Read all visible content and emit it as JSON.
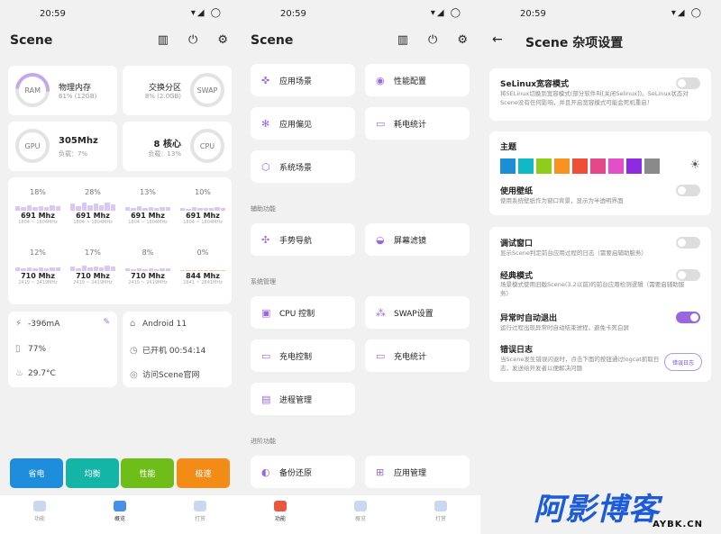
{
  "status": {
    "time": "20:59",
    "icons": "▾◢ ◯"
  },
  "s1": {
    "title": "Scene",
    "mem": {
      "ring": "RAM",
      "label": "物理内存",
      "sub": "61% (12GB)"
    },
    "swap": {
      "ring": "SWAP",
      "label": "交换分区",
      "sub": "8% (2.0GB)"
    },
    "gpu": {
      "ring": "GPU",
      "freq": "305Mhz",
      "sub": "负载：7%"
    },
    "cpu": {
      "ring": "CPU",
      "cores": "8 核心",
      "sub": "负载：13%"
    },
    "cores": [
      {
        "pct": "18%",
        "level": 18,
        "fq": "691 Mhz",
        "rg": "1804 ~ 1804MHz"
      },
      {
        "pct": "28%",
        "level": 28,
        "fq": "691 Mhz",
        "rg": "1804 ~ 1804MHz"
      },
      {
        "pct": "13%",
        "level": 13,
        "fq": "691 Mhz",
        "rg": "1804 ~ 1804MHz"
      },
      {
        "pct": "10%",
        "level": 10,
        "fq": "691 Mhz",
        "rg": "1804 ~ 1804MHz"
      },
      {
        "pct": "12%",
        "level": 12,
        "fq": "710 Mhz",
        "rg": "2419 ~ 2419MHz"
      },
      {
        "pct": "17%",
        "level": 17,
        "fq": "710 Mhz",
        "rg": "2419 ~ 2419MHz"
      },
      {
        "pct": "8%",
        "level": 8,
        "fq": "710 Mhz",
        "rg": "2419 ~ 2419MHz"
      },
      {
        "pct": "0%",
        "level": 0,
        "fq": "844 Mhz",
        "rg": "2841 ~ 2841MHz"
      }
    ],
    "battery": {
      "current": "-396mA",
      "level": "77%",
      "temp": "29.7°C"
    },
    "sys": {
      "android": "Android 11",
      "uptime_label": "已开机",
      "uptime": "00:54:14",
      "site": "访问Scene官网"
    },
    "modes": [
      "省电",
      "均衡",
      "性能",
      "极速"
    ],
    "nav": [
      "功能",
      "概览",
      "打赏"
    ]
  },
  "s2": {
    "title": "Scene",
    "tiles": [
      "应用场景",
      "性能配置",
      "应用偏见",
      "耗电统计",
      "系统场景"
    ],
    "sec1": "辅助功能",
    "aux": [
      "手势导航",
      "屏幕滤镜"
    ],
    "sec2": "系统管理",
    "mgr": [
      "CPU 控制",
      "SWAP设置",
      "充电控制",
      "充电统计",
      "进程管理"
    ],
    "sec3": "进阶功能",
    "adv": [
      "备份还原",
      "应用管理"
    ],
    "nav": [
      "功能",
      "概览",
      "打赏"
    ]
  },
  "s3": {
    "title": "Scene 杂项设置",
    "selinux": {
      "h": "SeLinux宽容模式",
      "d": "将SELinux切换到宽容模式(部分软件叫[关闭Selinux])。SeLinux状态对Scene没有任何影响，并且开启宽容模式可能会死机重启！"
    },
    "theme": {
      "h": "主题",
      "colors": [
        "#1a8fd6",
        "#10b9c6",
        "#8fcd1d",
        "#f7931e",
        "#ef4f37",
        "#e4488a",
        "#e24fc7",
        "#8e2be2",
        "#8a8a8a"
      ]
    },
    "wall": {
      "h": "使用壁纸",
      "d": "使用系统壁纸作为窗口背景，显示为半透明界面"
    },
    "debug": {
      "h": "调试窗口",
      "d": "显示Scene判定前台应用过程的日志（需要启辅助服务）"
    },
    "classic": {
      "h": "经典模式",
      "d": "场景模式使用旧版Scene(3.2以前)的前台应用检测逻辑（需要启辅助服务）"
    },
    "autoexit": {
      "h": "异常时自动退出",
      "d": "运行过程出现异常时自动结束进程，避免卡死白屏"
    },
    "errlog": {
      "h": "错误日志",
      "d": "当Scene发生错误闪退时，点击下面的按钮通过logcat抓取日志，发送给开发者以便解决问题",
      "btn": "错误日志"
    }
  },
  "watermark": {
    "brand": "阿影博客",
    "url": "AYBK.CN"
  }
}
